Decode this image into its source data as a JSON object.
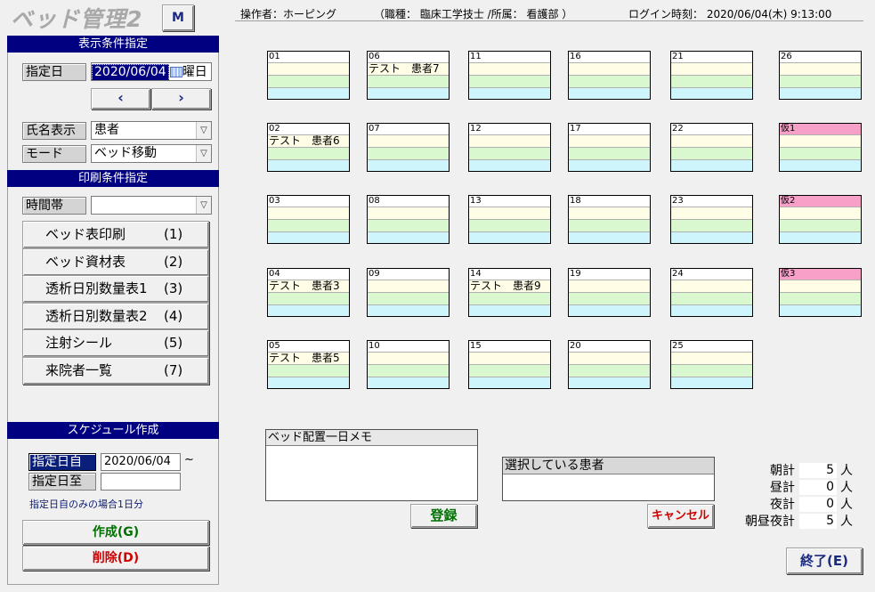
{
  "app": {
    "title": "ベッド管理2",
    "m_button": "M"
  },
  "header": {
    "operator": "操作者：ホーピング",
    "job": "（職種：  臨床工学技士  /所属：     看護部         ）",
    "login": "ログイン時刻：  2020/06/04(木) 9:13:00"
  },
  "display": {
    "section_title": "表示条件指定",
    "date_label": "指定日",
    "date_value": "2020/06/04",
    "weekday": "曜日",
    "prev_label": "‹",
    "next_label": "›",
    "name_label": "氏名表示",
    "name_value": "患者",
    "mode_label": "モード",
    "mode_value": "ベッド移動"
  },
  "print": {
    "section_title": "印刷条件指定",
    "time_label": "時間帯",
    "time_value": "",
    "buttons": [
      {
        "label": "ベッド表印刷",
        "key": "(1)"
      },
      {
        "label": "ベッド資材表",
        "key": "(2)"
      },
      {
        "label": "透析日別数量表1",
        "key": "(3)"
      },
      {
        "label": "透析日別数量表2",
        "key": "(4)"
      },
      {
        "label": "注射シール",
        "key": "(5)"
      },
      {
        "label": "来院者一覧",
        "key": "(7)"
      }
    ]
  },
  "schedule": {
    "section_title": "スケジュール作成",
    "from_label": "指定日自",
    "from_value": "2020/06/04",
    "tilde": "~",
    "to_label": "指定日至",
    "to_value": "",
    "note": "指定日自のみの場合1日分",
    "create_label": "作成(G)",
    "delete_label": "削除(D)"
  },
  "beds": [
    [
      {
        "id": "01",
        "patient": ""
      },
      {
        "id": "02",
        "patient": "テスト　患者6"
      },
      {
        "id": "03",
        "patient": ""
      },
      {
        "id": "04",
        "patient": "テスト　患者3"
      },
      {
        "id": "05",
        "patient": "テスト　患者5"
      }
    ],
    [
      {
        "id": "06",
        "patient": "テスト　患者7"
      },
      {
        "id": "07",
        "patient": ""
      },
      {
        "id": "08",
        "patient": ""
      },
      {
        "id": "09",
        "patient": ""
      },
      {
        "id": "10",
        "patient": ""
      }
    ],
    [
      {
        "id": "11",
        "patient": ""
      },
      {
        "id": "12",
        "patient": ""
      },
      {
        "id": "13",
        "patient": ""
      },
      {
        "id": "14",
        "patient": "テスト　患者9"
      },
      {
        "id": "15",
        "patient": ""
      }
    ],
    [
      {
        "id": "16",
        "patient": ""
      },
      {
        "id": "17",
        "patient": ""
      },
      {
        "id": "18",
        "patient": ""
      },
      {
        "id": "19",
        "patient": ""
      },
      {
        "id": "20",
        "patient": ""
      }
    ],
    [
      {
        "id": "21",
        "patient": ""
      },
      {
        "id": "22",
        "patient": ""
      },
      {
        "id": "23",
        "patient": ""
      },
      {
        "id": "24",
        "patient": ""
      },
      {
        "id": "25",
        "patient": ""
      }
    ],
    [
      {
        "id": "26",
        "patient": ""
      },
      {
        "id": "仮1",
        "patient": "",
        "temp": true
      },
      {
        "id": "仮2",
        "patient": "",
        "temp": true
      },
      {
        "id": "仮3",
        "patient": "",
        "temp": true
      }
    ]
  ],
  "memo": {
    "title": "ベッド配置一日メモ",
    "text": "",
    "register_label": "登録"
  },
  "selected": {
    "title": "選択している患者",
    "value": "",
    "cancel_label": "キャンセル"
  },
  "counts": [
    {
      "label": "朝計",
      "value": "5",
      "unit": "人"
    },
    {
      "label": "昼計",
      "value": "0",
      "unit": "人"
    },
    {
      "label": "夜計",
      "value": "0",
      "unit": "人"
    },
    {
      "label": "朝昼夜計",
      "value": "5",
      "unit": "人"
    }
  ],
  "exit_label": "終了(E)",
  "colors": {
    "header_navy": "#000080",
    "temp_bed": "#f7a0c8",
    "create_green": "#007000",
    "delete_red": "#d00000"
  }
}
